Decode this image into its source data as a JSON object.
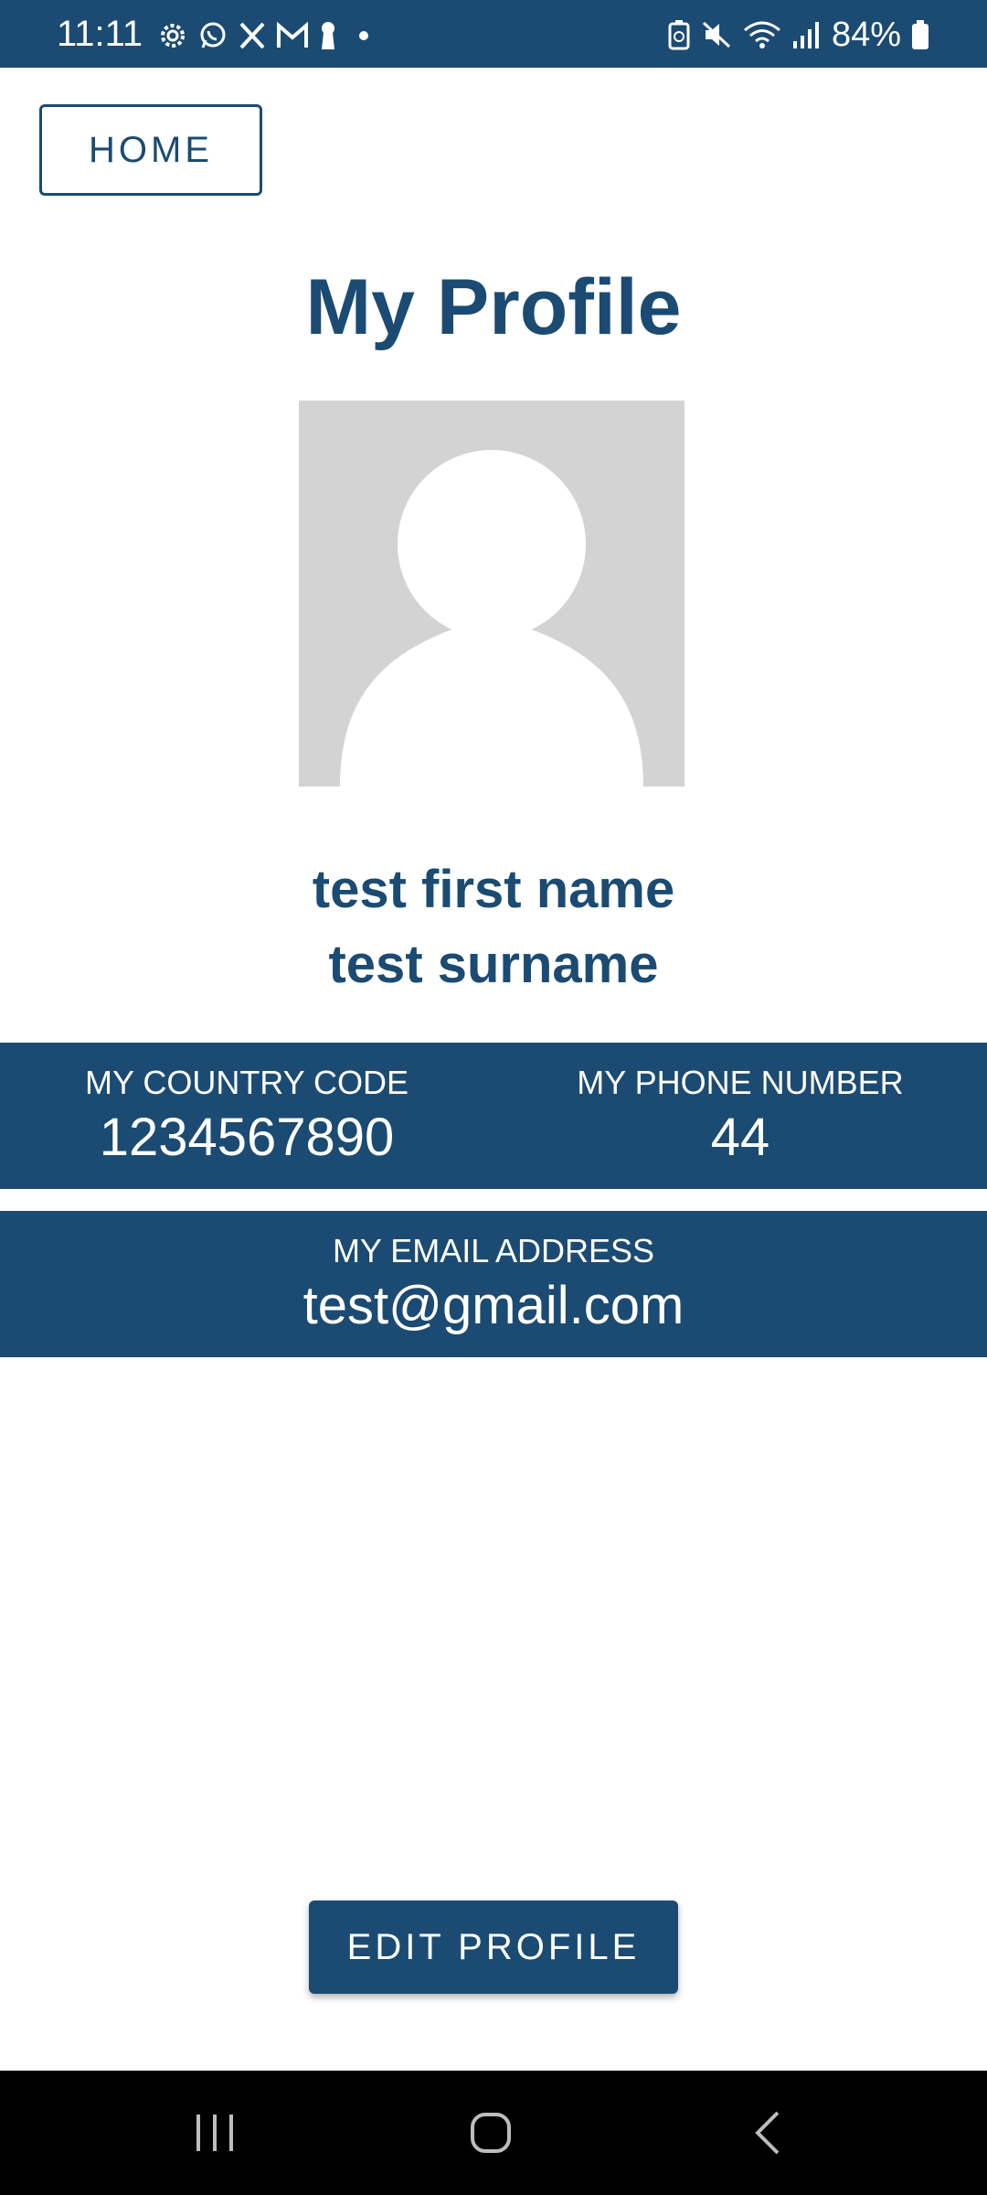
{
  "status_bar": {
    "time": "11:11",
    "battery": "84%",
    "left_icons": [
      "settings-gear-icon",
      "whatsapp-icon",
      "x-icon",
      "gmail-icon",
      "keyhole-icon",
      "dot-icon"
    ],
    "right_icons": [
      "battery-saver-icon",
      "mute-icon",
      "wifi-icon",
      "signal-icon",
      "battery-icon"
    ]
  },
  "header": {
    "home_label": "HOME",
    "title": "My Profile"
  },
  "profile": {
    "first_name": "test first name",
    "surname": "test surname",
    "country_code_label": "MY COUNTRY CODE",
    "country_code_value": "1234567890",
    "phone_label": "MY PHONE NUMBER",
    "phone_value": "44",
    "email_label": "MY EMAIL ADDRESS",
    "email_value": "test@gmail.com"
  },
  "actions": {
    "edit_label": "EDIT PROFILE"
  },
  "colors": {
    "primary": "#1b4b72",
    "avatar_bg": "#d3d3d3",
    "nav_bg": "#000000"
  }
}
